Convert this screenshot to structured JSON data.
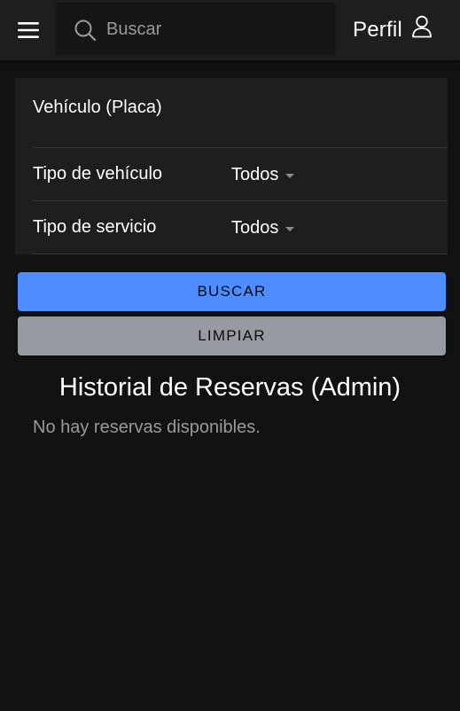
{
  "header": {
    "search_placeholder": "Buscar",
    "profile_label": "Perfil"
  },
  "filters": {
    "plate_label": "Vehículo (Placa)",
    "plate_value": "",
    "vehicle_type_label": "Tipo de vehículo",
    "vehicle_type_value": "Todos",
    "service_type_label": "Tipo de servicio",
    "service_type_value": "Todos"
  },
  "actions": {
    "search_label": "BUSCAR",
    "clear_label": "LIMPIAR"
  },
  "main": {
    "title": "Historial de Reservas (Admin)",
    "empty_message": "No hay reservas disponibles."
  },
  "colors": {
    "background": "#121212",
    "toolbar": "#1e1e1e",
    "primary": "#4d8dff",
    "medium": "#989aa2"
  },
  "icons": {
    "menu": "menu-icon",
    "search": "search-icon",
    "profile": "person-icon",
    "caret": "caret-down-icon"
  }
}
